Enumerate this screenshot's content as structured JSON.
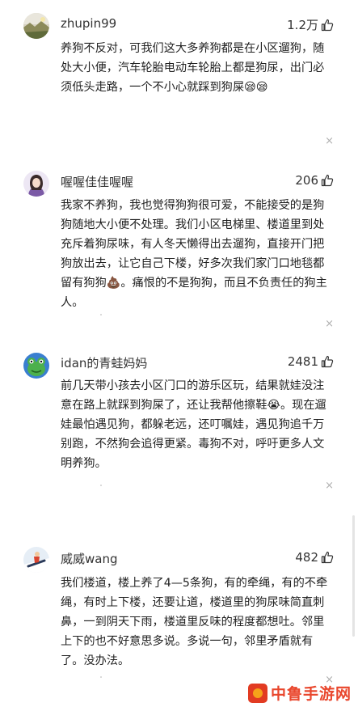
{
  "comments": [
    {
      "username": "zhupin99",
      "likes": "1.2万",
      "text": "养狗不反对，可我们这大多养狗都是在小区遛狗，随处大小便，汽车轮胎电动车轮胎上都是狗尿，出门必须低头走路，一个不小心就踩到狗屎😪😪",
      "avatar_icon": "landscape-avatar-icon"
    },
    {
      "username": "喔喔佳佳喔喔",
      "likes": "206",
      "text": "我家不养狗，我也觉得狗狗很可爱，不能接受的是狗狗随地大小便不处理。我们小区电梯里、楼道里到处充斥着狗尿味，有人冬天懒得出去遛狗，直接开门把狗放出去，让它自己下楼，好多次我们家门口地毯都留有狗狗💩。痛恨的不是狗狗，而且不负责任的狗主人。",
      "avatar_icon": "girl-avatar-icon"
    },
    {
      "username": "idan的青蛙妈妈",
      "likes": "2481",
      "text": "前几天带小孩去小区门口的游乐区玩，结果就娃没注意在路上就踩到狗屎了，还让我帮他擦鞋😭。现在遛娃最怕遇见狗，都躲老远，还叮嘱娃，遇见狗追千万别跑，不然狗会追得更紧。毒狗不对，呼吁更多人文明养狗。",
      "avatar_icon": "frog-avatar-icon"
    },
    {
      "username": "威威wang",
      "likes": "482",
      "text": "我们楼道，楼上养了4—5条狗，有的牵绳，有的不牵绳，有时上下楼，还要让道，楼道里的狗尿味简直刺鼻，一到阴天下雨，楼道里反味的程度都想吐。邻里上下的也不好意思多说。多说一句，邻里矛盾就有了。没办法。",
      "avatar_icon": "snowboard-avatar-icon"
    }
  ],
  "close_symbol": "×",
  "watermark": "中鲁手游网",
  "colors": {
    "text": "#222222",
    "muted": "#b0b0b0",
    "watermark": "#e9462c"
  }
}
